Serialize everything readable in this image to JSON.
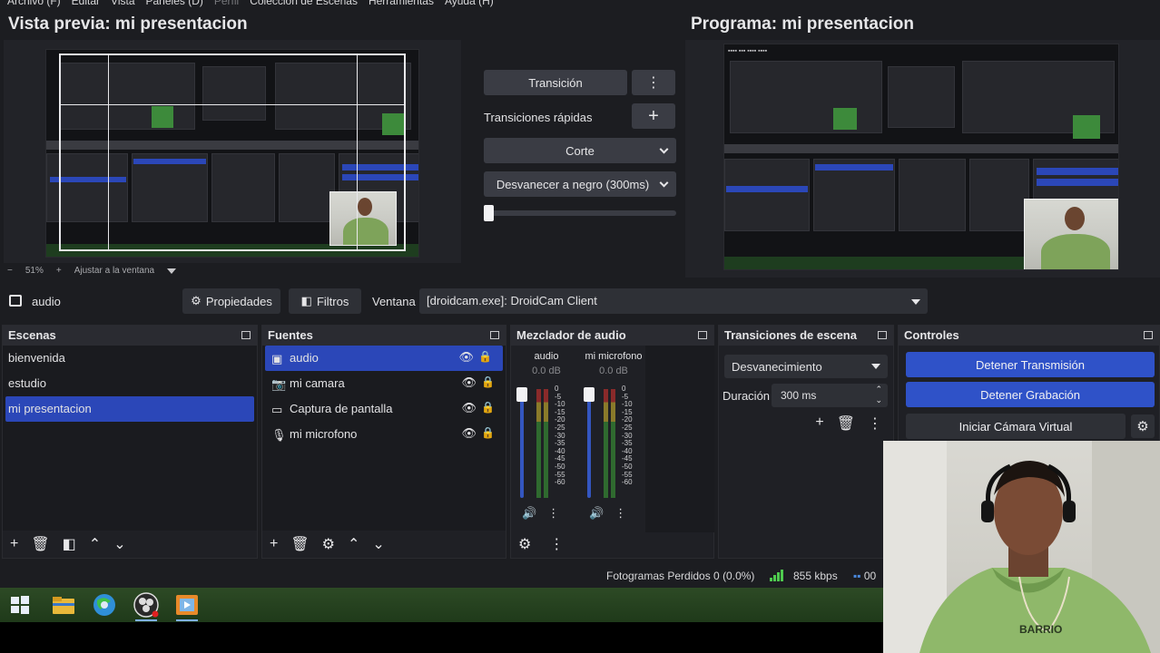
{
  "menu": [
    "Archivo (F)",
    "Editar",
    "Vista",
    "Paneles (D)",
    "Perfil",
    "Colección de Escenas",
    "Herramientas",
    "Ayuda (H)"
  ],
  "menu_disabled": [
    "Perfil"
  ],
  "preview": {
    "title": "Vista previa: mi presentacion",
    "zoom": "51%",
    "fit_label": "Ajustar a la ventana"
  },
  "program": {
    "title": "Programa: mi presentacion"
  },
  "transition_panel": {
    "transition_button": "Transición",
    "quick_transitions_label": "Transiciones rápidas",
    "cut_label": "Corte",
    "fade_black_label": "Desvanecer a negro (300ms)",
    "slider_value": 0
  },
  "source_toolbar": {
    "source_name": "audio",
    "properties_label": "Propiedades",
    "filters_label": "Filtros",
    "window_label": "Ventana",
    "window_value": "[droidcam.exe]: DroidCam Client"
  },
  "scenes": {
    "title": "Escenas",
    "items": [
      "bienvenida",
      "estudio",
      "mi presentacion"
    ],
    "active": "mi presentacion"
  },
  "sources": {
    "title": "Fuentes",
    "items": [
      {
        "name": "audio",
        "icon": "window-capture-icon"
      },
      {
        "name": "mi camara",
        "icon": "camera-icon"
      },
      {
        "name": "Captura de pantalla",
        "icon": "monitor-icon"
      },
      {
        "name": "mi microfono",
        "icon": "microphone-icon"
      }
    ],
    "active": "audio"
  },
  "mixer": {
    "title": "Mezclador de audio",
    "channels": [
      {
        "name": "audio",
        "db": "0.0 dB"
      },
      {
        "name": "mi microfono",
        "db": "0.0 dB"
      }
    ],
    "scale": [
      "0",
      "-5",
      "-10",
      "-15",
      "-20",
      "-25",
      "-30",
      "-35",
      "-40",
      "-45",
      "-50",
      "-55",
      "-60"
    ]
  },
  "scene_transitions": {
    "title": "Transiciones de escena",
    "selected": "Desvanecimiento",
    "duration_label": "Duración",
    "duration_value": "300 ms"
  },
  "controls": {
    "title": "Controles",
    "stop_stream": "Detener Transmisión",
    "stop_recording": "Detener Grabación",
    "virtual_cam": "Iniciar Cámara Virtual"
  },
  "status": {
    "dropped_frames": "Fotogramas Perdidos 0 (0.0%)",
    "bitrate": "855 kbps",
    "rec_time": "00"
  },
  "colors": {
    "accent": "#2f52c8",
    "panel": "#1f2025",
    "background": "#1c1d21"
  }
}
